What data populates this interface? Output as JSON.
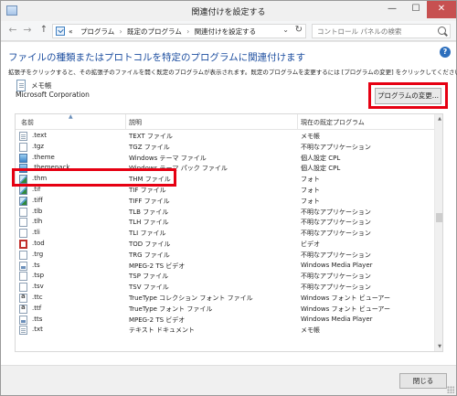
{
  "window": {
    "title": "関連付けを設定する",
    "buttons": {
      "minimize": "—",
      "maximize": "☐",
      "close": "✕"
    }
  },
  "address": {
    "back": "←",
    "forward": "→",
    "up": "↑",
    "prefix": "«",
    "crumbs": [
      "プログラム",
      "既定のプログラム",
      "関連付けを設定する"
    ],
    "separator": "›",
    "dropdown": "⌄",
    "refresh": "↻",
    "search_placeholder": "コントロール パネルの検索"
  },
  "content": {
    "help": "?",
    "heading": "ファイルの種類またはプロトコルを特定のプログラムに関連付けます",
    "description": "拡張子をクリックすると、その拡張子のファイルを開く既定のプログラムが表示されます。既定のプログラムを変更するには [プログラムの変更] をクリックしてください。",
    "program_name": "メモ帳",
    "program_company": "Microsoft Corporation",
    "change_button": "プログラムの変更..."
  },
  "list": {
    "columns": [
      "名前",
      "説明",
      "現在の既定プログラム"
    ],
    "rows": [
      {
        "name": ".text",
        "desc": "TEXT ファイル",
        "program": "メモ帳",
        "icon": "text-file-icon"
      },
      {
        "name": ".tgz",
        "desc": "TGZ ファイル",
        "program": "不明なアプリケーション",
        "icon": "generic-file-icon"
      },
      {
        "name": ".theme",
        "desc": "Windows テーマ ファイル",
        "program": "個人設定 CPL",
        "icon": "theme-icon"
      },
      {
        "name": ".themepack",
        "desc": "Windows テーマ パック ファイル",
        "program": "個人設定 CPL",
        "icon": "theme-icon"
      },
      {
        "name": ".thm",
        "desc": "THM ファイル",
        "program": "フォト",
        "icon": "image-icon"
      },
      {
        "name": ".tif",
        "desc": "TIF ファイル",
        "program": "フォト",
        "icon": "image-icon"
      },
      {
        "name": ".tiff",
        "desc": "TIFF ファイル",
        "program": "フォト",
        "icon": "image-icon"
      },
      {
        "name": ".tlb",
        "desc": "TLB ファイル",
        "program": "不明なアプリケーション",
        "icon": "generic-file-icon"
      },
      {
        "name": ".tlh",
        "desc": "TLH ファイル",
        "program": "不明なアプリケーション",
        "icon": "generic-file-icon"
      },
      {
        "name": ".tli",
        "desc": "TLI ファイル",
        "program": "不明なアプリケーション",
        "icon": "generic-file-icon"
      },
      {
        "name": ".tod",
        "desc": "TOD ファイル",
        "program": "ビデオ",
        "icon": "video-icon"
      },
      {
        "name": ".trg",
        "desc": "TRG ファイル",
        "program": "不明なアプリケーション",
        "icon": "generic-file-icon"
      },
      {
        "name": ".ts",
        "desc": "MPEG-2 TS ビデオ",
        "program": "Windows Media Player",
        "icon": "media-icon"
      },
      {
        "name": ".tsp",
        "desc": "TSP ファイル",
        "program": "不明なアプリケーション",
        "icon": "generic-file-icon"
      },
      {
        "name": ".tsv",
        "desc": "TSV ファイル",
        "program": "不明なアプリケーション",
        "icon": "generic-file-icon"
      },
      {
        "name": ".ttc",
        "desc": "TrueType コレクション フォント ファイル",
        "program": "Windows フォント ビューアー",
        "icon": "font-icon"
      },
      {
        "name": ".ttf",
        "desc": "TrueType フォント ファイル",
        "program": "Windows フォント ビューアー",
        "icon": "font-icon"
      },
      {
        "name": ".tts",
        "desc": "MPEG-2 TS ビデオ",
        "program": "Windows Media Player",
        "icon": "media-icon"
      },
      {
        "name": ".txt",
        "desc": "テキスト ドキュメント",
        "program": "メモ帳",
        "icon": "text-file-icon"
      }
    ]
  },
  "footer": {
    "close_button": "閉じる"
  },
  "colors": {
    "highlight": "#e60012",
    "heading": "#1e4fa0",
    "close": "#c75050"
  }
}
